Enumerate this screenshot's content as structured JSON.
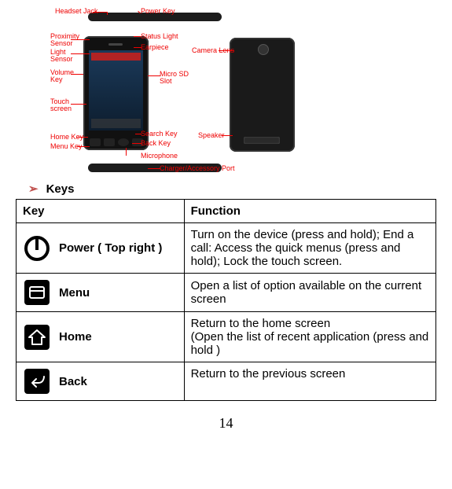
{
  "diagram": {
    "labels": {
      "headset_jack": "Headset Jack",
      "power_key": "Power Key",
      "proximity_sensor": "Proximity\nSensor",
      "light_sensor": "Light\nSensor",
      "status_light": "Status Light",
      "earpiece": "Earpiece",
      "volume_key": "Volume\nKey",
      "touch_screen": "Touch\nscreen",
      "micro_sd_slot": "Micro SD\nSlot",
      "home_key": "Home Key",
      "menu_key": "Menu Key",
      "search_key": "Search Key",
      "back_key": "Back Key",
      "microphone": "Microphone",
      "camera_lens": "Camera Lens",
      "speaker": "Speaker",
      "charger_port": "Charger/Accessory Port"
    }
  },
  "section_title": "Keys",
  "table": {
    "headers": {
      "key": "Key",
      "function": "Function"
    },
    "rows": [
      {
        "label": "Power ( Top    right )",
        "function": "Turn on the device (press and hold); End a call: Access the quick menus (press and hold); Lock the touch screen."
      },
      {
        "label": "Menu",
        "function": "Open a list of option available on the current screen"
      },
      {
        "label": "Home",
        "function": "Return to the home screen\n(Open the list of recent application (press and hold )"
      },
      {
        "label": "Back",
        "function": "Return to the previous screen"
      }
    ]
  },
  "page_number": "14"
}
